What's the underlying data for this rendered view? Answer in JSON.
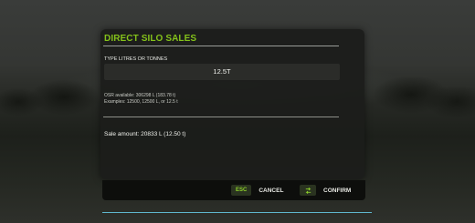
{
  "dialog": {
    "title": "DIRECT SILO SALES",
    "field_label": "TYPE LITRES OR TONNES",
    "input_value": "12.5T",
    "available_text": "OSR available: 306298 L (183.78 t)",
    "examples_text": "Examples: 12500, 12500 L, or 12.5 t",
    "sale_amount_text": "Sale amount: 20833 L (12.50 t)"
  },
  "footer": {
    "cancel_key": "ESC",
    "cancel_label": "CANCEL",
    "confirm_icon": "swap-arrows-icon",
    "confirm_label": "CONFIRM"
  },
  "colors": {
    "accent_green": "#84c21a",
    "bottom_line": "#5fb7cf"
  }
}
